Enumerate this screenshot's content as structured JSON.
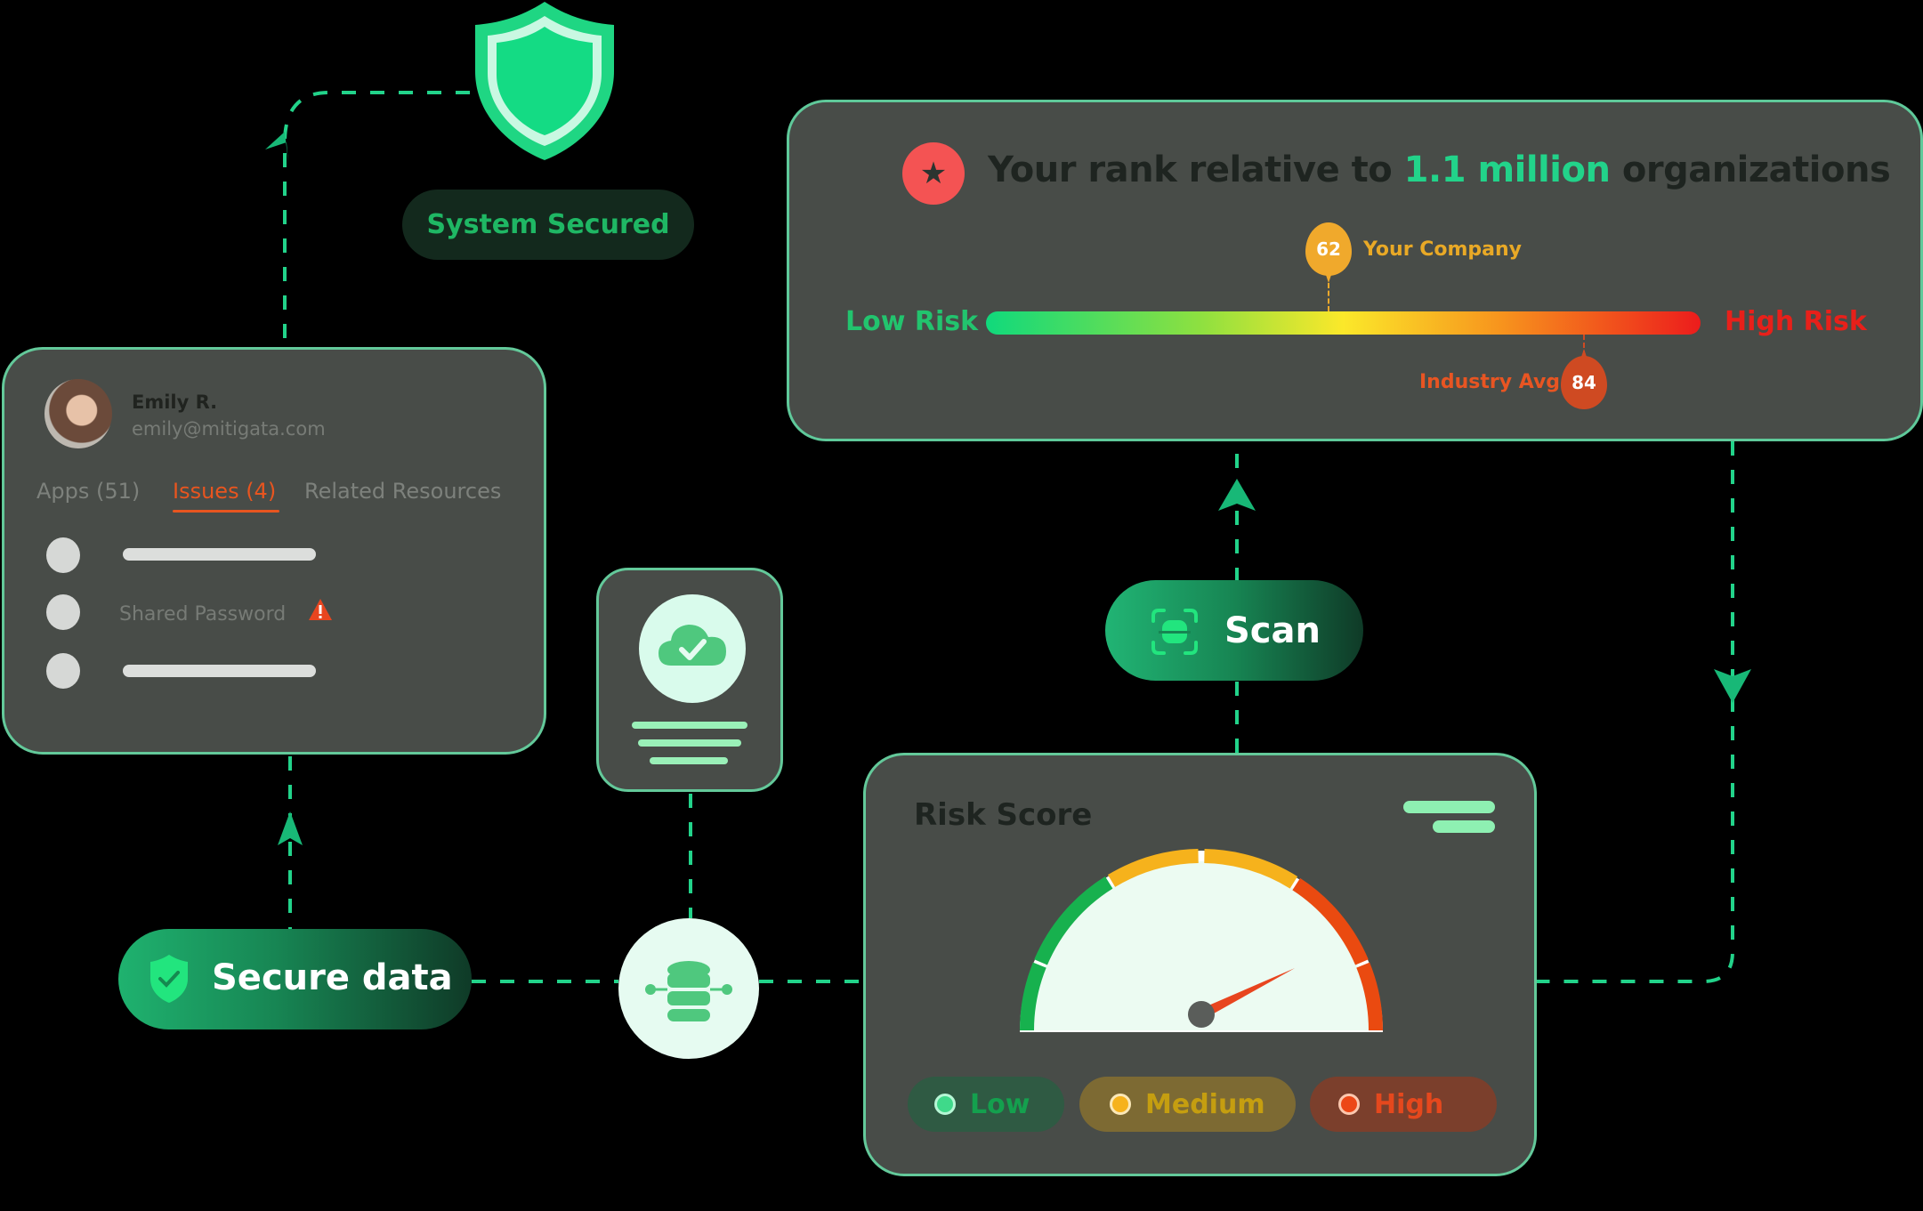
{
  "rank_card": {
    "title_prefix": "Your rank relative to ",
    "title_highlight": "1.1 million",
    "title_suffix": " organizations",
    "low_label": "Low Risk",
    "high_label": "High Risk",
    "company_score": "62",
    "company_label": "Your Company",
    "company_position_pct": 48,
    "industry_score": "84",
    "industry_label": "Industry Avg",
    "industry_position_pct": 84,
    "star_icon": "★"
  },
  "shield_badge": {
    "label": "System Secured"
  },
  "user_card": {
    "name": "Emily R.",
    "email": "emily@mitigata.com",
    "tabs": [
      {
        "label": "Apps (51)",
        "active": false
      },
      {
        "label": "Issues (4)",
        "active": true
      },
      {
        "label": "Related Resources",
        "active": false
      }
    ],
    "issues": [
      {
        "label": "",
        "placeholder": true
      },
      {
        "label": "Shared Password",
        "warning": true
      },
      {
        "label": "",
        "placeholder": true
      }
    ]
  },
  "secure_pill": {
    "label": "Secure data"
  },
  "scan_pill": {
    "label": "Scan"
  },
  "risk_card": {
    "title": "Risk Score",
    "needle_value_pct": 84,
    "legend": [
      {
        "label": "Low",
        "color": "#3fd98a"
      },
      {
        "label": "Medium",
        "color": "#f6b21c"
      },
      {
        "label": "High",
        "color": "#ec4717"
      }
    ]
  },
  "colors": {
    "accent": "#22d38a",
    "connector": "#22d38a",
    "card_bg": "#484c48",
    "warning": "#e8551f"
  }
}
